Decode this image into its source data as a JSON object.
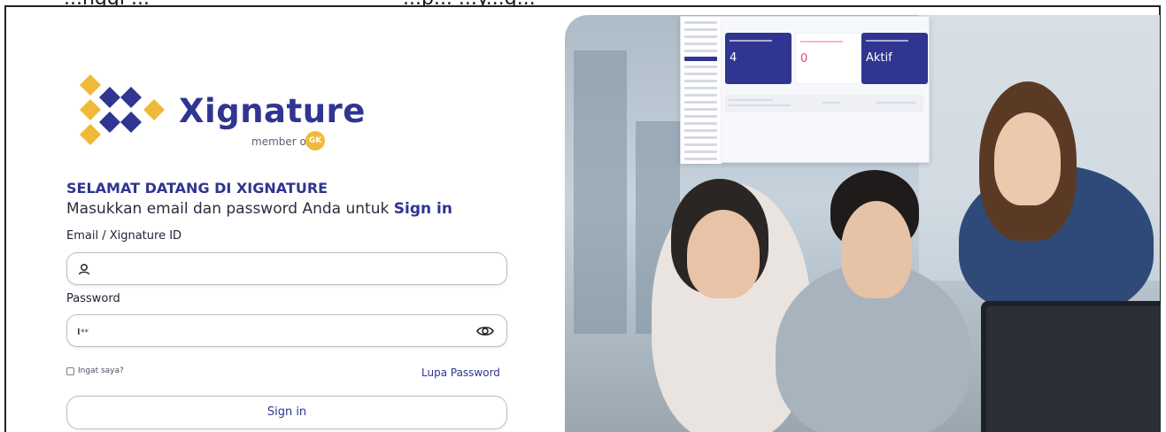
{
  "caption_fragment": {
    "left": "...nggi ...",
    "right": "...p... ...y...g..."
  },
  "brand": {
    "name": "Xignature",
    "member_of": "member of",
    "member_badge": "GK",
    "primary_color": "#2f3590",
    "accent_color": "#f1b93a"
  },
  "form": {
    "welcome_title": "SELAMAT DATANG DI XIGNATURE",
    "subtitle_prefix": "Masukkan email dan password Anda untuk ",
    "subtitle_emphasis": "Sign in",
    "email_label": "Email / Xignature ID",
    "email_value": "",
    "password_label": "Password",
    "password_value": "",
    "remember_label": "Ingat saya?",
    "forgot_label": "Lupa Password",
    "submit_label": "Sign in"
  },
  "dashboard_preview": {
    "cards": [
      {
        "value": "4",
        "color": "#2f3590"
      },
      {
        "value": "0",
        "color": "#ffffff"
      },
      {
        "value": "Aktif",
        "color": "#2f3590"
      }
    ]
  }
}
